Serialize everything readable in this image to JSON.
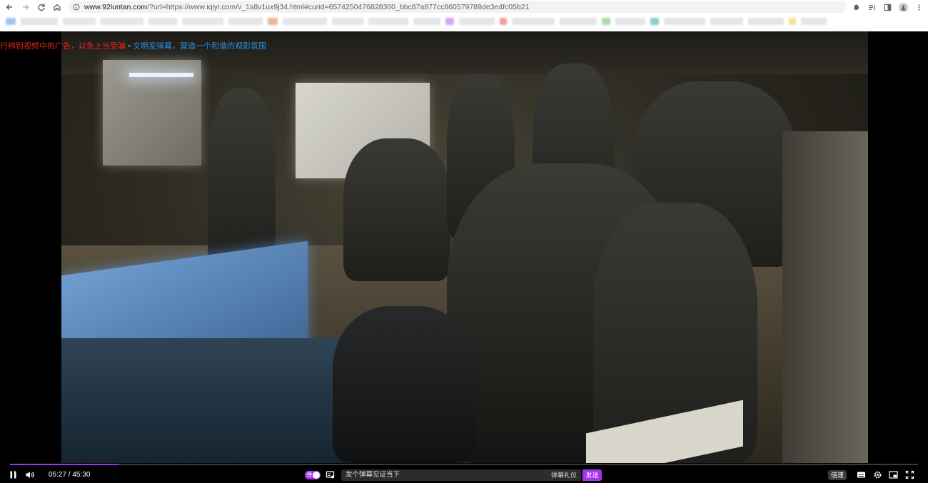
{
  "browser": {
    "url_host": "www.92luntan.com",
    "url_rest": "/?url=https://www.iqiyi.com/v_1s8v1ux9j34.html#curid=6574250476828300_bbc87a877cc860579789de3e4fc05b21",
    "icons": [
      "back-icon",
      "forward-icon",
      "reload-icon",
      "home-icon",
      "site-info-icon",
      "extensions-icon",
      "reading-list-icon",
      "tab-search-icon",
      "profile-icon",
      "menu-icon"
    ]
  },
  "notice": {
    "part1": "行辨别视频中的广告，以免上当受骗",
    "part2": "• 文明发弹幕，营造一个和谐的观影氛围"
  },
  "player": {
    "time": "05:27 / 45:30",
    "progress_fraction": 0.12,
    "danmu_toggle_label": "弹",
    "danmu_placeholder": "发个弹幕见证当下",
    "danmu_etiquette": "弹幕礼仪",
    "send_label": "发送",
    "speed_label": "倍速",
    "colors": {
      "accent": "#a431f0"
    }
  }
}
